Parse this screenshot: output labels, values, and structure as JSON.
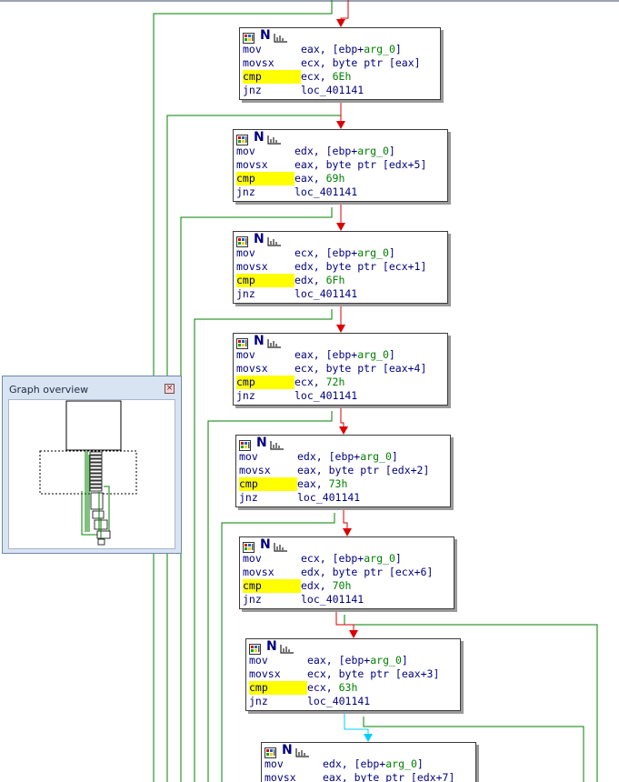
{
  "overview": {
    "title": "Graph overview",
    "close_icon": "close-icon"
  },
  "colors": {
    "mnemonic": "#000080",
    "operand_symbol": "#008000",
    "immediate": "#008000",
    "cmp_highlight": "#ffff00",
    "edge_taken": "#dd0000",
    "edge_fallthrough": "#008000",
    "edge_selected": "#00d0ff",
    "block_border": "#3a3a3a"
  },
  "header_icons": [
    "grid-icon",
    "n-icon",
    "chart-icon"
  ],
  "header_n": "N",
  "blocks": [
    {
      "lines": [
        {
          "m": "mov",
          "op": "eax, [ebp+",
          "sym": "arg_0",
          "tail": "]"
        },
        {
          "m": "movsx",
          "op": "ecx, byte ptr [eax]",
          "sym": "",
          "tail": ""
        },
        {
          "m": "cmp",
          "op": "ecx, ",
          "sym": "6Eh",
          "tail": ""
        },
        {
          "m": "jnz",
          "op": "loc_401141",
          "sym": "",
          "tail": ""
        }
      ]
    },
    {
      "lines": [
        {
          "m": "mov",
          "op": "edx, [ebp+",
          "sym": "arg_0",
          "tail": "]"
        },
        {
          "m": "movsx",
          "op": "eax, byte ptr [edx+5]",
          "sym": "",
          "tail": ""
        },
        {
          "m": "cmp",
          "op": "eax, ",
          "sym": "69h",
          "tail": ""
        },
        {
          "m": "jnz",
          "op": "loc_401141",
          "sym": "",
          "tail": ""
        }
      ]
    },
    {
      "lines": [
        {
          "m": "mov",
          "op": "ecx, [ebp+",
          "sym": "arg_0",
          "tail": "]"
        },
        {
          "m": "movsx",
          "op": "edx, byte ptr [ecx+1]",
          "sym": "",
          "tail": ""
        },
        {
          "m": "cmp",
          "op": "edx, ",
          "sym": "6Fh",
          "tail": ""
        },
        {
          "m": "jnz",
          "op": "loc_401141",
          "sym": "",
          "tail": ""
        }
      ]
    },
    {
      "lines": [
        {
          "m": "mov",
          "op": "eax, [ebp+",
          "sym": "arg_0",
          "tail": "]"
        },
        {
          "m": "movsx",
          "op": "ecx, byte ptr [eax+4]",
          "sym": "",
          "tail": ""
        },
        {
          "m": "cmp",
          "op": "ecx, ",
          "sym": "72h",
          "tail": ""
        },
        {
          "m": "jnz",
          "op": "loc_401141",
          "sym": "",
          "tail": ""
        }
      ]
    },
    {
      "lines": [
        {
          "m": "mov",
          "op": "edx, [ebp+",
          "sym": "arg_0",
          "tail": "]"
        },
        {
          "m": "movsx",
          "op": "eax, byte ptr [edx+2]",
          "sym": "",
          "tail": ""
        },
        {
          "m": "cmp",
          "op": "eax, ",
          "sym": "73h",
          "tail": ""
        },
        {
          "m": "jnz",
          "op": "loc_401141",
          "sym": "",
          "tail": ""
        }
      ]
    },
    {
      "lines": [
        {
          "m": "mov",
          "op": "ecx, [ebp+",
          "sym": "arg_0",
          "tail": "]"
        },
        {
          "m": "movsx",
          "op": "edx, byte ptr [ecx+6]",
          "sym": "",
          "tail": ""
        },
        {
          "m": "cmp",
          "op": "edx, ",
          "sym": "70h",
          "tail": ""
        },
        {
          "m": "jnz",
          "op": "loc_401141",
          "sym": "",
          "tail": ""
        }
      ]
    },
    {
      "lines": [
        {
          "m": "mov",
          "op": "eax, [ebp+",
          "sym": "arg_0",
          "tail": "]"
        },
        {
          "m": "movsx",
          "op": "ecx, byte ptr [eax+3]",
          "sym": "",
          "tail": ""
        },
        {
          "m": "cmp",
          "op": "ecx, ",
          "sym": "63h",
          "tail": ""
        },
        {
          "m": "jnz",
          "op": "loc_401141",
          "sym": "",
          "tail": ""
        }
      ]
    },
    {
      "lines": [
        {
          "m": "mov",
          "op": "edx, [ebp+",
          "sym": "arg_0",
          "tail": "]"
        },
        {
          "m": "movsx",
          "op": "eax, byte ptr [edx+7]",
          "sym": "",
          "tail": ""
        }
      ]
    }
  ]
}
